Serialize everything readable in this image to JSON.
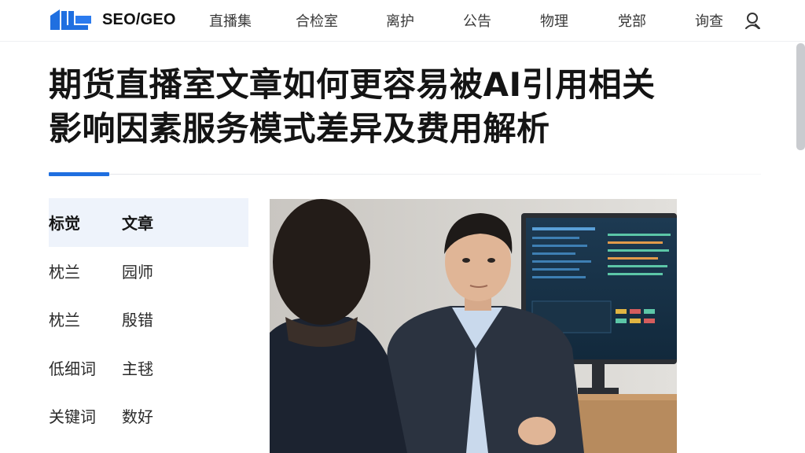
{
  "header": {
    "logo_text": "SEO/GEO",
    "nav": [
      "直播集",
      "合检室",
      "离护",
      "公告",
      "物理",
      "党部",
      "询查"
    ],
    "user_icon": "user-icon"
  },
  "article": {
    "title_line1": "期货直播室文章如何更容易被AI引用相关",
    "title_line2": "影响因素服务模式差异及费用解析"
  },
  "info_table": {
    "header": [
      "标觉",
      "文章"
    ],
    "rows": [
      [
        "枕兰",
        "园师"
      ],
      [
        "枕兰",
        "殷错"
      ],
      [
        "低细词",
        "主毬"
      ],
      [
        "关键词",
        "数好"
      ]
    ]
  },
  "colors": {
    "accent": "#1f6fe0",
    "logo": "#1f6fe0",
    "table_header_bg": "#eef3fb"
  },
  "icons": {
    "logo": "brand-logo-icon",
    "user": "user-icon"
  }
}
